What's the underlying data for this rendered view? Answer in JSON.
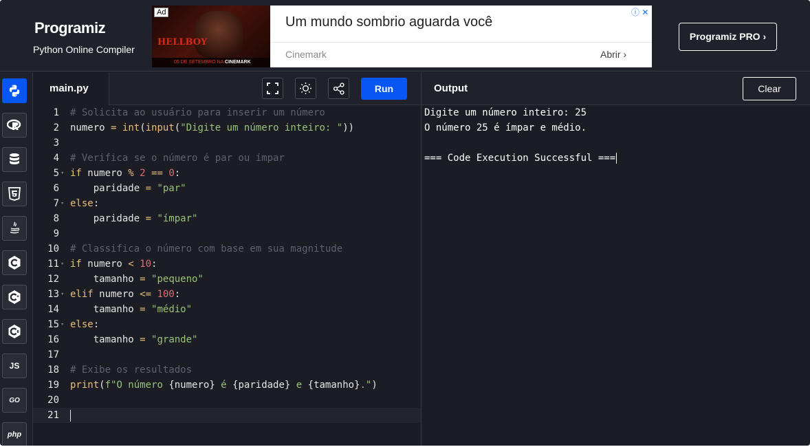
{
  "header": {
    "logo_text": "Programiz",
    "subtitle": "Python Online Compiler",
    "pro_button": "Programiz PRO ›"
  },
  "ad": {
    "badge": "Ad",
    "image_title": "HELLBOY",
    "image_strip_date": "05 DE SETEMBRO NA",
    "image_strip_brand": "CINEMARK",
    "headline": "Um mundo sombrio aguarda você",
    "source": "Cinemark",
    "cta": "Abrir ›",
    "icons": "ⓘ ✕"
  },
  "sidebar": {
    "items": [
      {
        "name": "python",
        "icon": "python-icon",
        "active": true
      },
      {
        "name": "r",
        "icon": "r-icon",
        "active": false
      },
      {
        "name": "sql",
        "icon": "database-icon",
        "active": false
      },
      {
        "name": "html",
        "icon": "html5-icon",
        "active": false
      },
      {
        "name": "java",
        "icon": "java-icon",
        "active": false
      },
      {
        "name": "c",
        "icon": "c-icon",
        "label": "C",
        "active": false
      },
      {
        "name": "cpp",
        "icon": "cpp-icon",
        "label": "C",
        "active": false
      },
      {
        "name": "csharp",
        "icon": "csharp-icon",
        "label": "C",
        "active": false
      },
      {
        "name": "js",
        "icon": "js-icon",
        "label": "JS",
        "active": false
      },
      {
        "name": "go",
        "icon": "go-icon",
        "label": "GO",
        "active": false
      },
      {
        "name": "php",
        "icon": "php-icon",
        "label": "php",
        "active": false
      }
    ]
  },
  "editor": {
    "file_tab": "main.py",
    "run_label": "Run",
    "toolbar_icons": [
      "fullscreen-icon",
      "theme-toggle-icon",
      "share-icon"
    ],
    "line_numbers": [
      "1",
      "2",
      "3",
      "4",
      "5",
      "6",
      "7",
      "8",
      "9",
      "10",
      "11",
      "12",
      "13",
      "14",
      "15",
      "16",
      "17",
      "18",
      "19",
      "20",
      "21"
    ],
    "lines": [
      [
        {
          "t": "cm",
          "v": "# Solicita ao usuário para inserir um número"
        }
      ],
      [
        {
          "t": "tx",
          "v": "numero "
        },
        {
          "t": "op",
          "v": "="
        },
        {
          "t": "tx",
          "v": " "
        },
        {
          "t": "kw",
          "v": "int"
        },
        {
          "t": "tx",
          "v": "("
        },
        {
          "t": "kw",
          "v": "input"
        },
        {
          "t": "tx",
          "v": "("
        },
        {
          "t": "str",
          "v": "\"Digite um número inteiro: \""
        },
        {
          "t": "tx",
          "v": "))"
        }
      ],
      [],
      [
        {
          "t": "cm",
          "v": "# Verifica se o número é par ou ímpar"
        }
      ],
      [
        {
          "t": "kw",
          "v": "if"
        },
        {
          "t": "tx",
          "v": " numero "
        },
        {
          "t": "op",
          "v": "%"
        },
        {
          "t": "tx",
          "v": " "
        },
        {
          "t": "num",
          "v": "2"
        },
        {
          "t": "tx",
          "v": " "
        },
        {
          "t": "op",
          "v": "=="
        },
        {
          "t": "tx",
          "v": " "
        },
        {
          "t": "num",
          "v": "0"
        },
        {
          "t": "tx",
          "v": ":"
        }
      ],
      [
        {
          "t": "tx",
          "v": "    paridade "
        },
        {
          "t": "op",
          "v": "="
        },
        {
          "t": "tx",
          "v": " "
        },
        {
          "t": "str",
          "v": "\"par\""
        }
      ],
      [
        {
          "t": "kw",
          "v": "else"
        },
        {
          "t": "tx",
          "v": ":"
        }
      ],
      [
        {
          "t": "tx",
          "v": "    paridade "
        },
        {
          "t": "op",
          "v": "="
        },
        {
          "t": "tx",
          "v": " "
        },
        {
          "t": "str",
          "v": "\"ímpar\""
        }
      ],
      [],
      [
        {
          "t": "cm",
          "v": "# Classifica o número com base em sua magnitude"
        }
      ],
      [
        {
          "t": "kw",
          "v": "if"
        },
        {
          "t": "tx",
          "v": " numero "
        },
        {
          "t": "op",
          "v": "<"
        },
        {
          "t": "tx",
          "v": " "
        },
        {
          "t": "num",
          "v": "10"
        },
        {
          "t": "tx",
          "v": ":"
        }
      ],
      [
        {
          "t": "tx",
          "v": "    tamanho "
        },
        {
          "t": "op",
          "v": "="
        },
        {
          "t": "tx",
          "v": " "
        },
        {
          "t": "str",
          "v": "\"pequeno\""
        }
      ],
      [
        {
          "t": "kw",
          "v": "elif"
        },
        {
          "t": "tx",
          "v": " numero "
        },
        {
          "t": "op",
          "v": "<="
        },
        {
          "t": "tx",
          "v": " "
        },
        {
          "t": "num",
          "v": "100"
        },
        {
          "t": "tx",
          "v": ":"
        }
      ],
      [
        {
          "t": "tx",
          "v": "    tamanho "
        },
        {
          "t": "op",
          "v": "="
        },
        {
          "t": "tx",
          "v": " "
        },
        {
          "t": "str",
          "v": "\"médio\""
        }
      ],
      [
        {
          "t": "kw",
          "v": "else"
        },
        {
          "t": "tx",
          "v": ":"
        }
      ],
      [
        {
          "t": "tx",
          "v": "    tamanho "
        },
        {
          "t": "op",
          "v": "="
        },
        {
          "t": "tx",
          "v": " "
        },
        {
          "t": "str",
          "v": "\"grande\""
        }
      ],
      [],
      [
        {
          "t": "cm",
          "v": "# Exibe os resultados"
        }
      ],
      [
        {
          "t": "kw",
          "v": "print"
        },
        {
          "t": "tx",
          "v": "("
        },
        {
          "t": "str",
          "v": "f\"O número "
        },
        {
          "t": "tx",
          "v": "{numero}"
        },
        {
          "t": "str",
          "v": " é "
        },
        {
          "t": "tx",
          "v": "{paridade}"
        },
        {
          "t": "str",
          "v": " e "
        },
        {
          "t": "tx",
          "v": "{tamanho}"
        },
        {
          "t": "str",
          "v": ".\""
        },
        {
          "t": "tx",
          "v": ")"
        }
      ],
      [],
      []
    ],
    "foldable_lines": [
      5,
      7,
      11,
      13,
      15
    ],
    "current_line": 21
  },
  "output": {
    "title": "Output",
    "clear_label": "Clear",
    "lines": [
      "Digite um número inteiro: 25",
      "O número 25 é ímpar e médio.",
      "",
      "=== Code Execution Successful ==="
    ]
  },
  "colors": {
    "accent": "#0556f3",
    "background": "#1b1c24",
    "panel": "#20222b",
    "comment": "#5d6170",
    "keyword": "#e5c07b",
    "number": "#e06c75",
    "string": "#98c379"
  }
}
